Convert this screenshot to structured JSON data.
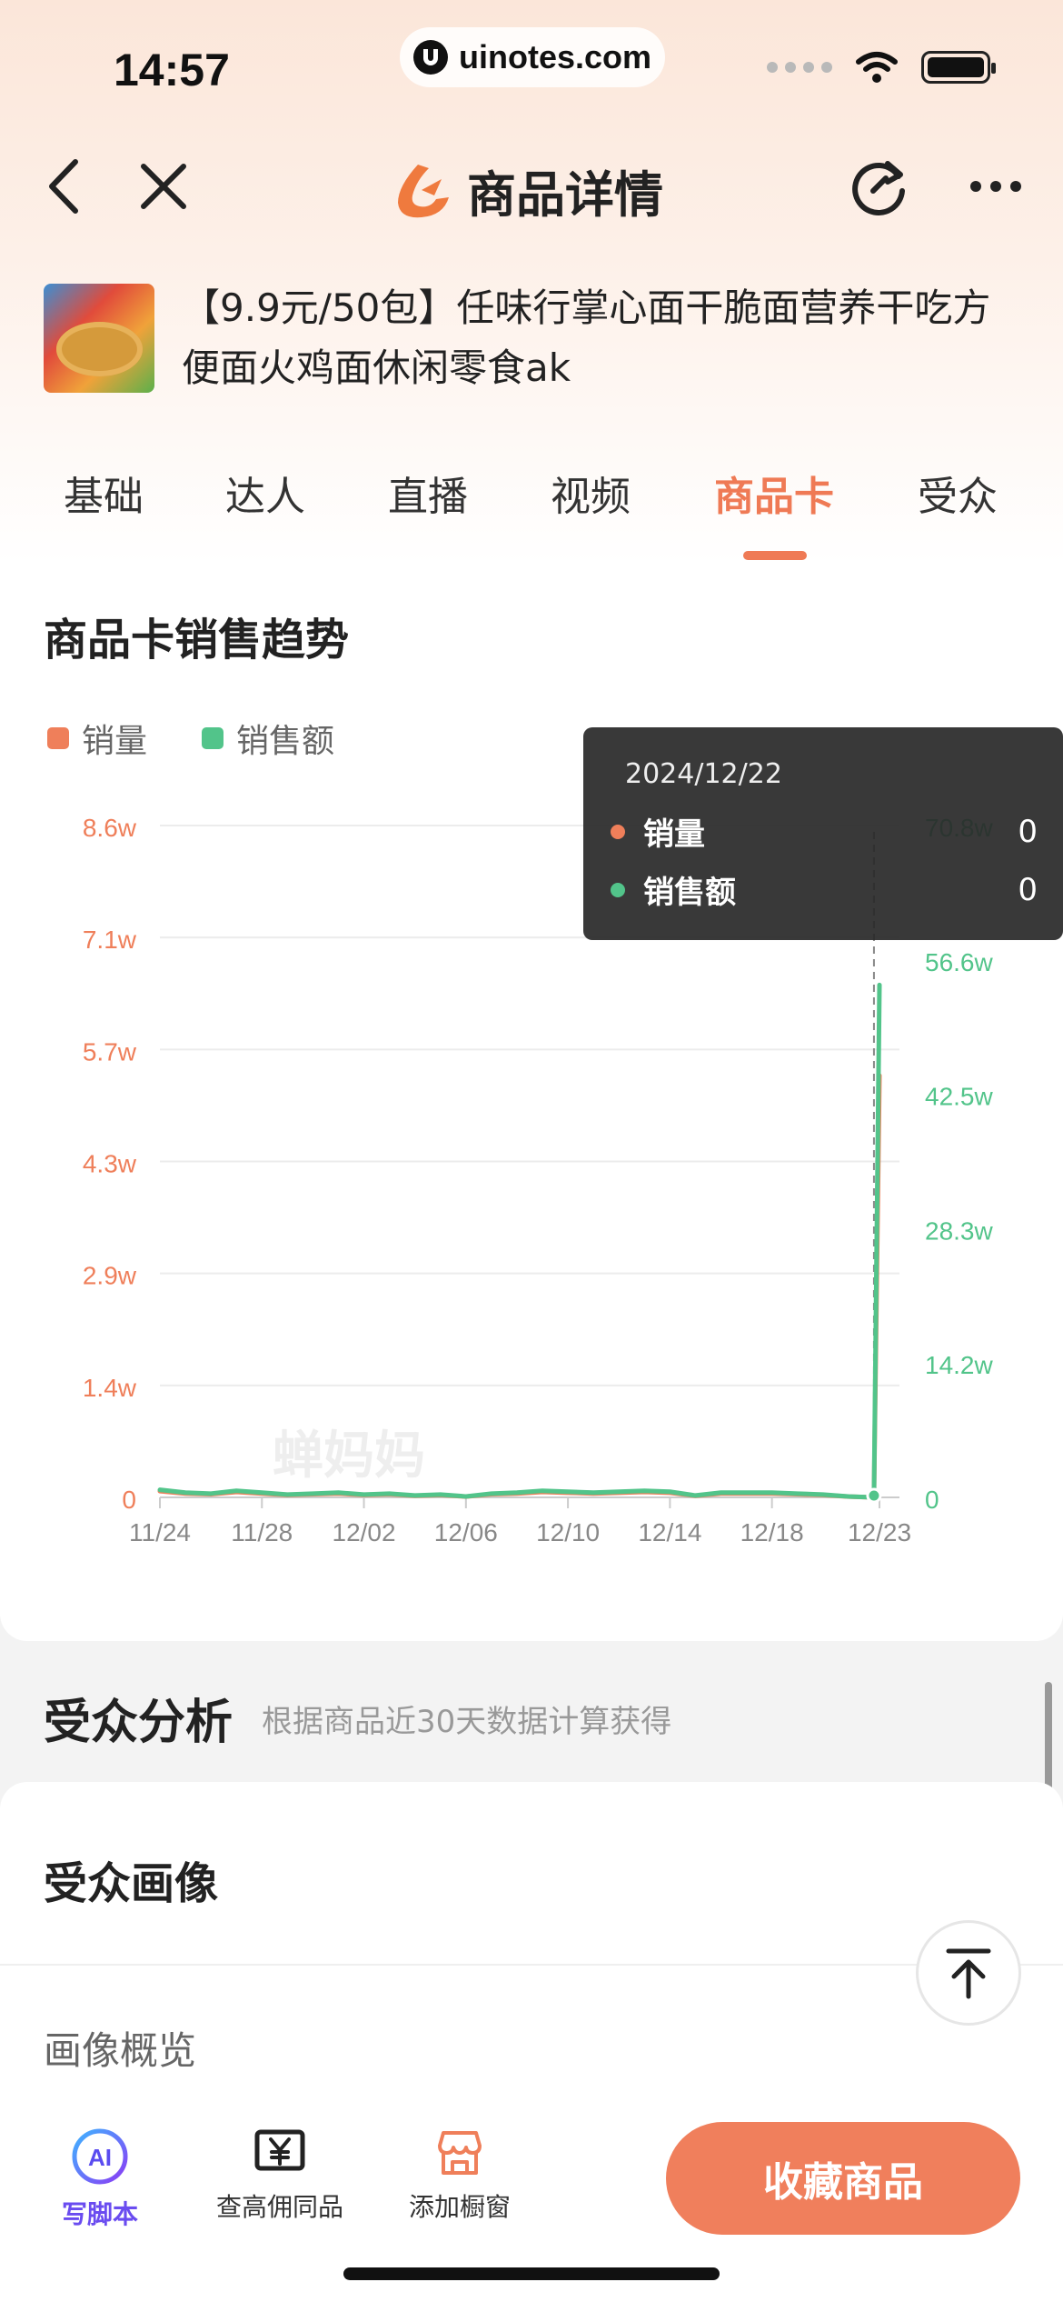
{
  "status_bar": {
    "time": "14:57",
    "url": "uinotes.com"
  },
  "header": {
    "title": "商品详情",
    "back_icon": "chevron-left-icon",
    "close_icon": "close-icon",
    "refresh_icon": "refresh-icon",
    "more_icon": "more-icon"
  },
  "product": {
    "title": "【9.9元/50包】任味行掌心面干脆面营养干吃方便面火鸡面休闲零食ak"
  },
  "tabs": [
    {
      "label": "基础",
      "active": false
    },
    {
      "label": "达人",
      "active": false
    },
    {
      "label": "直播",
      "active": false
    },
    {
      "label": "视频",
      "active": false
    },
    {
      "label": "商品卡",
      "active": true
    },
    {
      "label": "受众",
      "active": false
    }
  ],
  "chart_section": {
    "title": "商品卡销售趋势",
    "watermark": "蝉妈妈",
    "tooltip": {
      "date": "2024/12/22",
      "rows": [
        {
          "name": "销量",
          "value": "0"
        },
        {
          "name": "销售额",
          "value": "0"
        }
      ]
    }
  },
  "chart_data": {
    "type": "line",
    "x_ticks": [
      "11/24",
      "11/28",
      "12/02",
      "12/06",
      "12/10",
      "12/14",
      "12/18",
      "12/23"
    ],
    "y_left_ticks": [
      "0",
      "1.4w",
      "2.9w",
      "4.3w",
      "5.7w",
      "7.1w",
      "8.6w"
    ],
    "y_right_ticks": [
      "0",
      "14.2w",
      "28.3w",
      "42.5w",
      "56.6w",
      "70.8w"
    ],
    "ylim_left": [
      0,
      86000
    ],
    "ylim_right": [
      0,
      708000
    ],
    "grid": true,
    "legend_position": "top-left",
    "x": [
      "11/24",
      "11/25",
      "11/26",
      "11/27",
      "11/28",
      "11/29",
      "11/30",
      "12/01",
      "12/02",
      "12/03",
      "12/04",
      "12/05",
      "12/06",
      "12/07",
      "12/08",
      "12/09",
      "12/10",
      "12/11",
      "12/12",
      "12/13",
      "12/14",
      "12/15",
      "12/16",
      "12/17",
      "12/18",
      "12/19",
      "12/20",
      "12/21",
      "12/22",
      "12/23"
    ],
    "series": [
      {
        "name": "销量",
        "axis": "left",
        "color": "#ef7f5a",
        "values": [
          800,
          500,
          400,
          700,
          500,
          300,
          400,
          500,
          300,
          400,
          200,
          300,
          100,
          400,
          500,
          700,
          600,
          500,
          600,
          700,
          600,
          200,
          500,
          500,
          500,
          400,
          300,
          100,
          0,
          54000
        ]
      },
      {
        "name": "销售额",
        "axis": "right",
        "color": "#52c48a",
        "values": [
          8000,
          5000,
          4000,
          7000,
          5000,
          3000,
          4000,
          5000,
          3000,
          4000,
          2000,
          3000,
          1000,
          4000,
          5000,
          7000,
          6000,
          5000,
          6000,
          7000,
          6000,
          2000,
          5000,
          5000,
          5000,
          4000,
          3000,
          1000,
          0,
          540000
        ]
      }
    ]
  },
  "audience": {
    "heading": "受众分析",
    "subheading": "根据商品近30天数据计算获得",
    "card_title": "受众画像",
    "overview": "画像概览"
  },
  "bottom_bar": {
    "items": [
      {
        "label": "写脚本",
        "icon": "ai-icon"
      },
      {
        "label": "查高佣同品",
        "icon": "yen-icon"
      },
      {
        "label": "添加橱窗",
        "icon": "store-icon"
      }
    ],
    "primary_button": "收藏商品"
  }
}
